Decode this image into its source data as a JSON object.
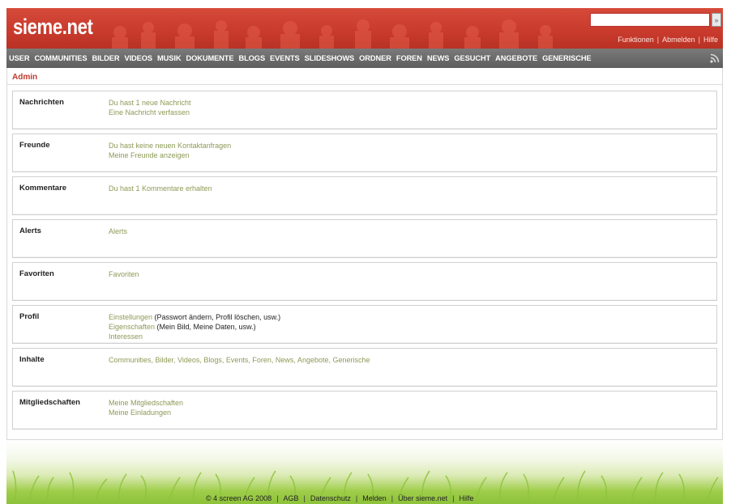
{
  "header": {
    "logo": "sieme.net",
    "search_value": "",
    "search_button": "»",
    "links": [
      "Funktionen",
      "Abmelden",
      "Hilfe"
    ],
    "separator": "|"
  },
  "nav": {
    "items": [
      "USER",
      "COMMUNITIES",
      "BILDER",
      "VIDEOS",
      "MUSIK",
      "DOKUMENTE",
      "BLOGS",
      "EVENTS",
      "SLIDESHOWS",
      "ORDNER",
      "FOREN",
      "NEWS",
      "GESUCHT",
      "ANGEBOTE",
      "GENERISCHE"
    ],
    "rss_icon": "rss-icon"
  },
  "admin": {
    "title": "Admin",
    "sections": [
      {
        "label": "Nachrichten",
        "lines": [
          {
            "link": "Du hast 1 neue Nachricht",
            "note": ""
          },
          {
            "link": "Eine Nachricht verfassen",
            "note": ""
          }
        ]
      },
      {
        "label": "Freunde",
        "lines": [
          {
            "link": "Du hast keine neuen Kontaktanfragen",
            "note": ""
          },
          {
            "link": "Meine Freunde anzeigen",
            "note": ""
          }
        ]
      },
      {
        "label": "Kommentare",
        "lines": [
          {
            "link": "Du hast 1 Kommentare erhalten",
            "note": ""
          }
        ]
      },
      {
        "label": "Alerts",
        "lines": [
          {
            "link": "Alerts",
            "note": ""
          }
        ]
      },
      {
        "label": "Favoriten",
        "lines": [
          {
            "link": "Favoriten",
            "note": ""
          }
        ]
      },
      {
        "label": "Profil",
        "lines": [
          {
            "link": "Einstellungen",
            "note": " (Passwort ändern, Profil löschen, usw.)"
          },
          {
            "link": "Eigenschaften",
            "note": " (Mein Bild, Meine Daten, usw.)"
          },
          {
            "link": "Interessen",
            "note": ""
          }
        ]
      },
      {
        "label": "Inhalte",
        "lines": [
          {
            "link": "Communities, Bilder, Videos, Blogs, Events, Foren, News, Angebote, Generische",
            "note": ""
          }
        ]
      },
      {
        "label": "Mitgliedschaften",
        "lines": [
          {
            "link": "Meine Mitgliedschaften",
            "note": ""
          },
          {
            "link": "Meine Einladungen",
            "note": ""
          }
        ]
      }
    ]
  },
  "footer": {
    "links": [
      "© 4 screen AG 2008",
      "AGB",
      "Datenschutz",
      "Melden",
      "Über sieme.net",
      "Hilfe"
    ],
    "separator": "|"
  },
  "colors": {
    "header_red": "#c83a2c",
    "nav_gray": "#6a6a6a",
    "link_olive": "#8c9a56",
    "admin_red": "#c0392b",
    "grass_green": "#8cc23a"
  }
}
